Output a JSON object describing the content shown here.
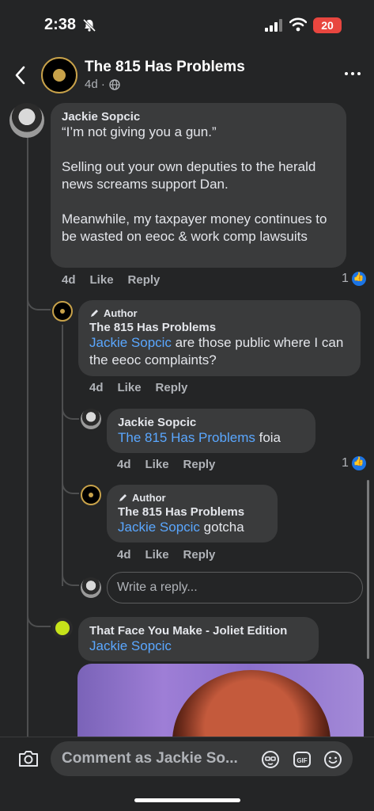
{
  "status_bar": {
    "time": "2:38",
    "battery": "20"
  },
  "header": {
    "title": "The 815 Has Problems",
    "meta": "4d ·"
  },
  "comments": [
    {
      "author": "Jackie Sopcic",
      "text": "“I’m not giving you a gun.”\n\nSelling out your own deputies to the herald news screams support Dan.\n\nMeanwhile, my taxpayer money continues to be wasted on eeoc & work comp lawsuits",
      "age": "4d",
      "like": "Like",
      "reply": "Reply",
      "likes": "1"
    },
    {
      "badge": "Author",
      "author": "The 815 Has Problems",
      "mention": "Jackie Sopcic",
      "text": " are those public where I can the eeoc complaints?",
      "age": "4d",
      "like": "Like",
      "reply": "Reply"
    },
    {
      "author": "Jackie Sopcic",
      "mention": "The 815 Has Problems",
      "text": " foia",
      "age": "4d",
      "like": "Like",
      "reply": "Reply",
      "likes": "1"
    },
    {
      "badge": "Author",
      "author": "The 815 Has Problems",
      "mention": "Jackie Sopcic",
      "text": " gotcha",
      "age": "4d",
      "like": "Like",
      "reply": "Reply"
    },
    {
      "author": "That Face You Make - Joliet Edition",
      "mention": "Jackie Sopcic"
    }
  ],
  "reply_placeholder": "Write a reply...",
  "composer": {
    "placeholder": "Comment as Jackie So..."
  },
  "icons": [
    "bell-slash-icon",
    "signal-icon",
    "wifi-icon",
    "back-icon",
    "globe-icon",
    "more-icon",
    "pencil-icon",
    "like-icon",
    "camera-icon",
    "avatar-sticker-icon",
    "gif-icon",
    "emoji-icon"
  ],
  "colors": {
    "background": "#242526",
    "bubble": "#3a3b3c",
    "mention": "#5aa7ff",
    "like_blue": "#1b74e4"
  }
}
